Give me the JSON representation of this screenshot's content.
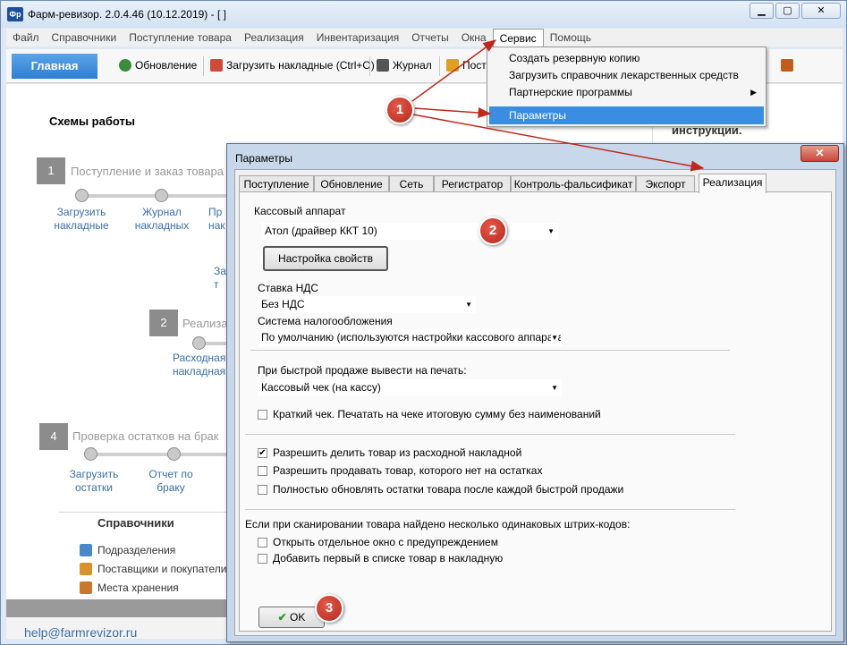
{
  "window": {
    "title": "Фарм-ревизор. 2.0.4.46 (10.12.2019) - [ ]",
    "app_icon_text": "Фр",
    "buttons": {
      "minimize": "▁",
      "maximize": "▢",
      "close": "✕"
    }
  },
  "menubar": [
    "Файл",
    "Справочники",
    "Поступление товара",
    "Реализация",
    "Инвентаризация",
    "Отчеты",
    "Окна",
    "Сервис",
    "Помощь"
  ],
  "toolbar": {
    "home": "Главная",
    "buttons": [
      "Обновление",
      "Загрузить накладные (Ctrl+O)",
      "Журнал",
      "Посту"
    ]
  },
  "main": {
    "schemes_title": "Схемы работы",
    "steps": [
      {
        "num": "1",
        "label": "Поступление и заказ товара"
      },
      {
        "num": "2",
        "label": "Реализа"
      },
      {
        "num": "4",
        "label": "Проверка остатков на брак"
      }
    ],
    "links": {
      "load_invoices": "Загрузить\nнакладные",
      "invoice_journal": "Журнал\nнакладных",
      "pr_frag": "Пр\nнак",
      "zag_frag": "Заг\nт",
      "outgoing_invoice": "Расходная\nнакладная",
      "load_stock": "Загрузить\nостатки",
      "defect_report": "Отчет по\nбраку"
    },
    "references_title": "Справочники",
    "references": [
      "Подразделения",
      "Поставщики и покупатели",
      "Места хранения"
    ],
    "right_panel_text": "инструкции.",
    "help_email": "help@farmrevizor.ru"
  },
  "dropdown": {
    "items": [
      "Создать резервную копию",
      "Загрузить справочник лекарственных средств",
      "Партнерские программы",
      "Параметры"
    ],
    "submenu_arrow": "▶"
  },
  "dialog": {
    "title": "Параметры",
    "close": "✕",
    "tabs": [
      "Поступление",
      "Обновление",
      "Сеть",
      "Регистратор",
      "Контроль-фальсификат",
      "Экспорт",
      "Реализация"
    ],
    "cash_register_label": "Кассовый аппарат",
    "cash_register_value": "Атол (драйвер ККТ 10)",
    "settings_button": "Настройка свойств",
    "vat_label": "Ставка НДС",
    "vat_value": "Без НДС",
    "tax_label": "Система налогообложения",
    "tax_value": "По умолчанию (используются настройки кассового аппарата",
    "print_label": "При быстрой продаже вывести на печать:",
    "print_value": "Кассовый чек (на кассу)",
    "short_receipt": "Краткий чек. Печатать на чеке итоговую сумму без наименований",
    "allow_split": "Разрешить делить товар из расходной накладной",
    "allow_sell_missing": "Разрешить продавать товар, которого нет на остатках",
    "full_update": "Полностью обновлять остатки товара после каждой быстрой продажи",
    "barcode_label": "Если при сканировании товара найдено несколько одинаковых штрих-кодов:",
    "open_window": "Открыть отдельное окно с предупреждением",
    "add_first": "Добавить первый в списке товар в накладную",
    "ok": "OK",
    "checks": {
      "short_receipt": false,
      "allow_split": true,
      "allow_sell_missing": false,
      "full_update": false,
      "open_window": false,
      "add_first": false
    },
    "checkmark": "✔"
  },
  "badges": [
    "1",
    "2",
    "3"
  ],
  "colors": {
    "accent": "#3a8de0",
    "badge": "#c7392b",
    "link": "#3a6fa8",
    "arrow": "#c0281c"
  }
}
